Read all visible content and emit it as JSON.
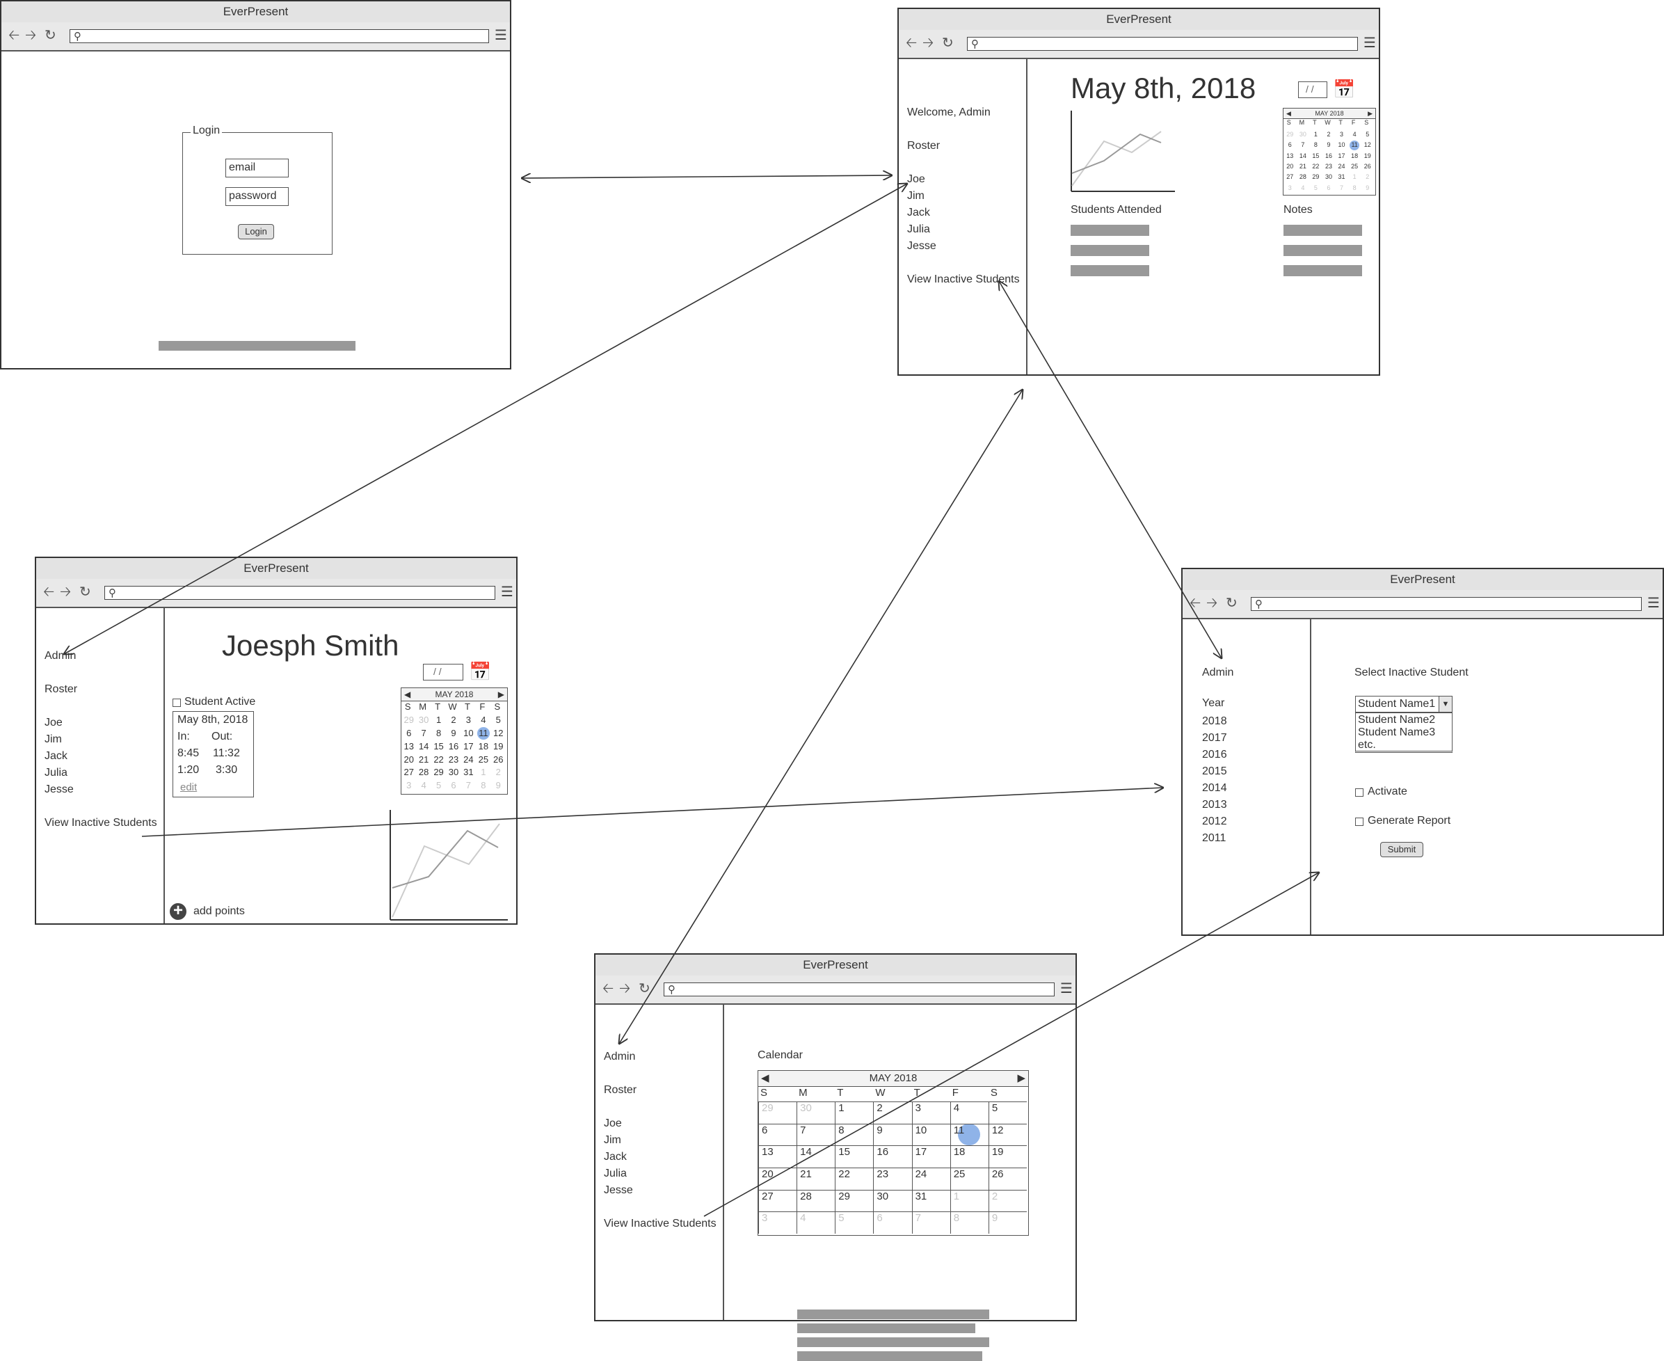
{
  "app_title": "EverPresent",
  "login": {
    "group_label": "Login",
    "email_placeholder": "email",
    "password_placeholder": "password",
    "button": "Login"
  },
  "dashboard": {
    "date_heading": "May 8th, 2018",
    "welcome": "Welcome, Admin",
    "roster": "Roster",
    "students": [
      "Joe",
      "Jim",
      "Jack",
      "Julia",
      "Jesse"
    ],
    "view_inactive": "View Inactive Students",
    "students_attended": "Students Attended",
    "notes": "Notes",
    "date_input": "/ /"
  },
  "student": {
    "name": "Joesph Smith",
    "admin": "Admin",
    "roster": "Roster",
    "students": [
      "Joe",
      "Jim",
      "Jack",
      "Julia",
      "Jesse"
    ],
    "view_inactive": "View Inactive Students",
    "active_label": "Student Active",
    "attendance_date": "May 8th, 2018",
    "in_label": "In:",
    "out_label": "Out:",
    "rows": [
      [
        "8:45",
        "11:32"
      ],
      [
        "1:20",
        "3:30"
      ]
    ],
    "edit": "edit",
    "add_points": "add points",
    "date_input": "/ /"
  },
  "inactive": {
    "admin": "Admin",
    "year_label": "Year",
    "years": [
      "2018",
      "2017",
      "2016",
      "2015",
      "2014",
      "2013",
      "2012",
      "2011"
    ],
    "select_label": "Select Inactive Student",
    "selected": "Student Name1",
    "options": [
      "Student Name2",
      "Student Name3",
      "etc."
    ],
    "activate": "Activate",
    "generate_report": "Generate Report",
    "submit": "Submit"
  },
  "calendar_page": {
    "admin": "Admin",
    "roster": "Roster",
    "students": [
      "Joe",
      "Jim",
      "Jack",
      "Julia",
      "Jesse"
    ],
    "view_inactive": "View Inactive Students",
    "calendar_label": "Calendar"
  },
  "calendar": {
    "month": "MAY 2018",
    "weekdays": [
      "S",
      "M",
      "T",
      "W",
      "T",
      "F",
      "S"
    ],
    "weeks": [
      [
        "29",
        "30",
        "1",
        "2",
        "3",
        "4",
        "5"
      ],
      [
        "6",
        "7",
        "8",
        "9",
        "10",
        "11",
        "12"
      ],
      [
        "13",
        "14",
        "15",
        "16",
        "17",
        "18",
        "19"
      ],
      [
        "20",
        "21",
        "22",
        "23",
        "24",
        "25",
        "26"
      ],
      [
        "27",
        "28",
        "29",
        "30",
        "31",
        "1",
        "2"
      ],
      [
        "3",
        "4",
        "5",
        "6",
        "7",
        "8",
        "9"
      ]
    ],
    "selected": "11",
    "highlight_color": "#8fb3e8"
  }
}
